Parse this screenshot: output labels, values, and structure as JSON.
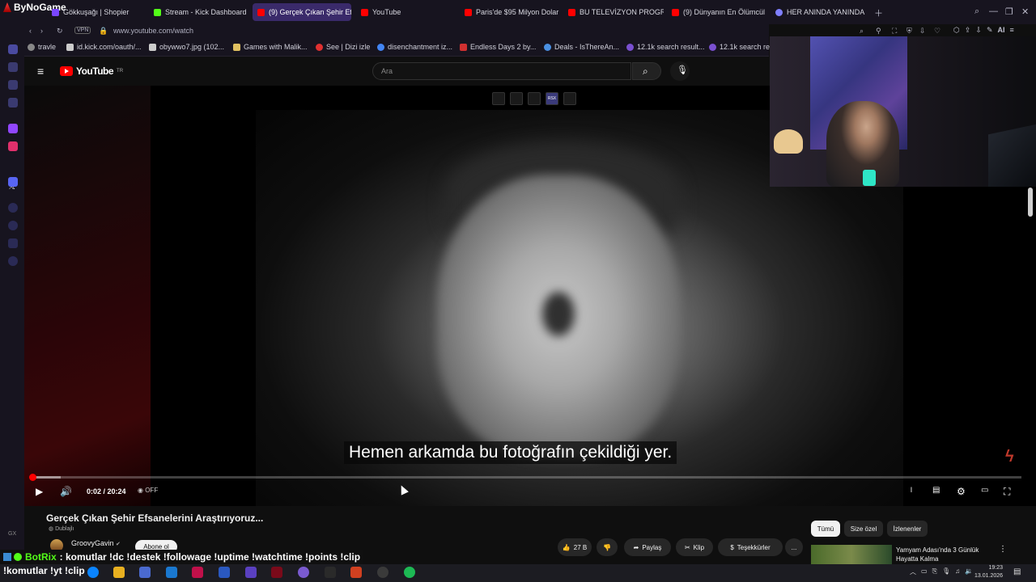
{
  "browser": {
    "brand": "ByNoGame",
    "tabs": [
      {
        "label": "Gökkuşağı | Shopier",
        "icon": "shopier-icon"
      },
      {
        "label": "Stream - Kick Dashboard",
        "icon": "kick-icon"
      },
      {
        "label": "(9) Gerçek Çıkan Şehir Ef",
        "icon": "youtube-icon",
        "active": true
      },
      {
        "label": "YouTube",
        "icon": "youtube-icon"
      },
      {
        "label": "Paris'de $95 Milyon Dolar",
        "icon": "youtube-icon"
      },
      {
        "label": "BU TELEVİZYON PROGRA",
        "icon": "youtube-icon"
      },
      {
        "label": "(9) Dünyanın En Ölümcül",
        "icon": "youtube-icon"
      },
      {
        "label": "HER ANINDA YANINDA",
        "icon": "opera-icon"
      }
    ],
    "address": {
      "vpn": "VPN",
      "url": "www.youtube.com/watch"
    },
    "bookmarks": [
      "travle",
      "id.kick.com/oauth/...",
      "obywwo7.jpg (102...",
      "Games with Malik...",
      "See | Dizi izle",
      "disenchantment iz...",
      "Endless Days 2 by...",
      "Deals - IsThereAn...",
      "12.1k search result...",
      "12.1k search res"
    ],
    "ai_label": "AI"
  },
  "youtube": {
    "logo": "YouTube",
    "region": "TR",
    "search_placeholder": "Ara"
  },
  "player": {
    "subtitle": "Hemen arkamda bu fotoğrafın çekildiği yer.",
    "time": "0:02 / 20:24",
    "progress_fraction": 0.0016,
    "buffer_fraction": 0.03,
    "autoplay_label": "OFF",
    "ext_label": "RSX"
  },
  "video": {
    "title": "Gerçek Çıkan Şehir Efsanelerini Araştırıyoruz...",
    "dub": "Dublajlı",
    "channel": "GroovyGavin",
    "subscribe": "Abone ol",
    "likes": "27 B",
    "share": "Paylaş",
    "clip": "Klip",
    "thanks": "Teşekkürler",
    "more": "..."
  },
  "recommend": {
    "chips": [
      "Tümü",
      "Size özel",
      "İzlenenler"
    ],
    "selected": "Tümü",
    "first_title": "Yamyam Adası'nda 3 Günlük Hayatta Kalma"
  },
  "chat": {
    "line1_user": "BotRix",
    "line1_text": ": komutlar !dc !destek !followage !uptime !watchtime !points !clip",
    "line2_text": "!komutlar !yt !clip"
  },
  "taskbar": {
    "time": "19:23",
    "date": "13.01.2026"
  },
  "colors": {
    "accent": "#ff0000",
    "kick": "#53fc18",
    "tab_active": "#3a2a6a"
  }
}
